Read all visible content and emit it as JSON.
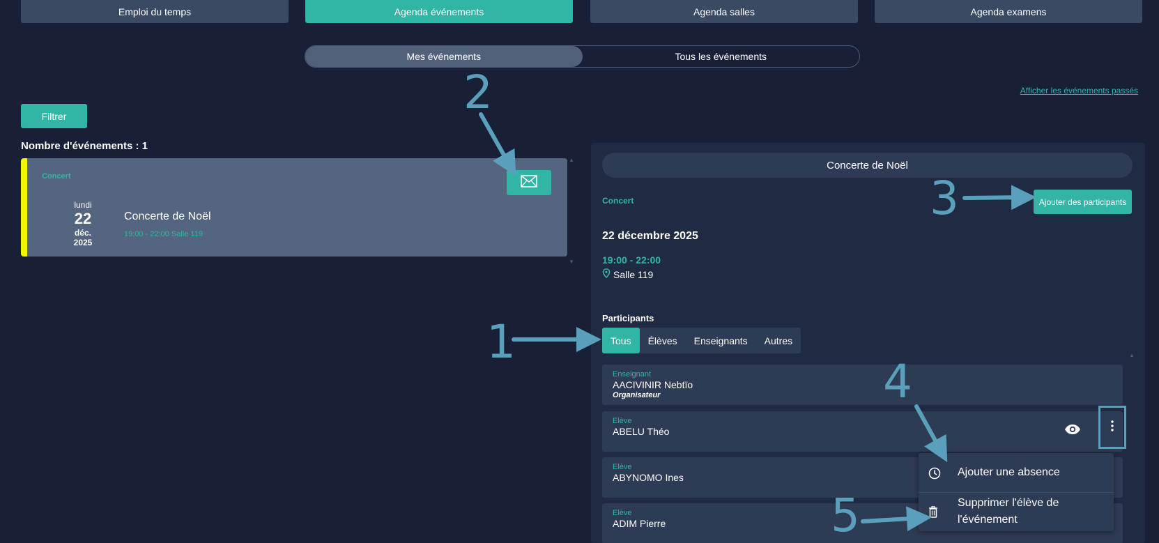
{
  "nav": {
    "tabs": [
      {
        "label": "Emploi du temps"
      },
      {
        "label": "Agenda événements"
      },
      {
        "label": "Agenda salles"
      },
      {
        "label": "Agenda examens"
      }
    ]
  },
  "segmented": {
    "mine": "Mes événements",
    "all": "Tous les événements"
  },
  "past_link": "Afficher les événements passés",
  "filter_label": "Filtrer",
  "count_label": "Nombre d'événements : 1",
  "event": {
    "type": "Concert",
    "dow": "lundi",
    "day": "22",
    "month": "déc.",
    "year": "2025",
    "title": "Concerte de Noël",
    "subtitle": "19:00 - 22:00 Salle 119"
  },
  "detail": {
    "title": "Concerte de Noël",
    "type": "Concert",
    "add_participants": "Ajouter des participants",
    "date": "22 décembre 2025",
    "time": "19:00 - 22:00",
    "location": "Salle 119",
    "participants_label": "Participants",
    "tabs": [
      {
        "label": "Tous"
      },
      {
        "label": "Élèves"
      },
      {
        "label": "Enseignants"
      },
      {
        "label": "Autres"
      }
    ],
    "participants": [
      {
        "role": "Enseignant",
        "name": "AACIVINIR Nebtïo",
        "extra": "Organisateur"
      },
      {
        "role": "Elève",
        "name": "ABELU Théo"
      },
      {
        "role": "Elève",
        "name": "ABYNOMO Ines"
      },
      {
        "role": "Elève",
        "name": "ADIM Pierre"
      }
    ]
  },
  "menu": {
    "add_absence": "Ajouter une absence",
    "remove_line1": "Supprimer l'élève de",
    "remove_line2": "l'événement"
  },
  "annotations": [
    "1",
    "2",
    "3",
    "4",
    "5"
  ],
  "colors": {
    "background": "#172036",
    "accent": "#33b5a5",
    "card": "#54657f",
    "panel": "#1f2b42",
    "annotation": "#5aa0bc",
    "event_marker": "#f5f500"
  }
}
